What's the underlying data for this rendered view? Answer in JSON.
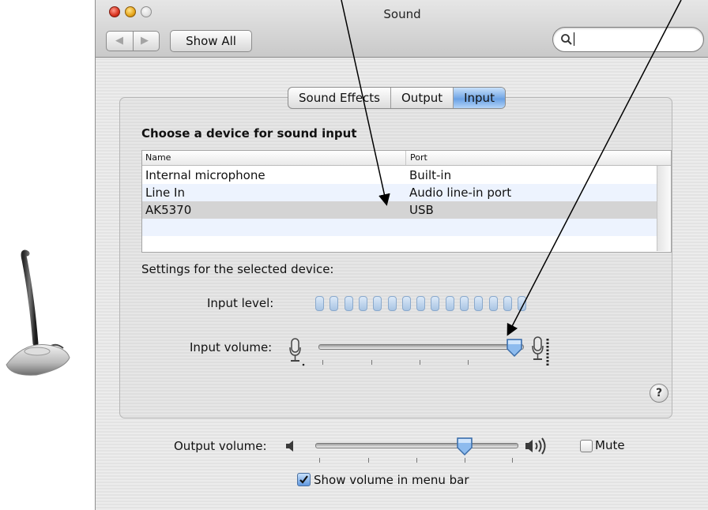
{
  "window": {
    "title": "Sound"
  },
  "toolbar": {
    "show_all_label": "Show All",
    "search_value": ""
  },
  "tabs": [
    {
      "label": "Sound Effects",
      "active": false
    },
    {
      "label": "Output",
      "active": false
    },
    {
      "label": "Input",
      "active": true
    }
  ],
  "input": {
    "section_title": "Choose a device for sound input",
    "table": {
      "columns": [
        "Name",
        "Port"
      ],
      "rows": [
        {
          "name": "Internal microphone",
          "port": "Built-in",
          "selected": false
        },
        {
          "name": "Line In",
          "port": "Audio line-in port",
          "selected": false
        },
        {
          "name": "AK5370",
          "port": "USB",
          "selected": true
        }
      ]
    },
    "settings_label": "Settings for the selected device:",
    "input_level_label": "Input level:",
    "input_level_segments": 15,
    "input_volume_label": "Input volume:",
    "input_volume_level": 0.93
  },
  "output": {
    "volume_label": "Output volume:",
    "volume_level": 0.72,
    "mute_label": "Mute",
    "mute_checked": false,
    "show_in_menubar_label": "Show volume in menu bar",
    "show_in_menubar_checked": true
  },
  "help_label": "?",
  "colors": {
    "accent": "#6aa1e4",
    "selected_row": "#d4d4d4",
    "alt_row": "#edf3fe",
    "annotation_arrows": "#000000"
  },
  "icons": [
    "microphone-stand-image",
    "search-icon",
    "microphone-icon",
    "speaker-low-icon",
    "speaker-high-icon",
    "help-icon"
  ]
}
